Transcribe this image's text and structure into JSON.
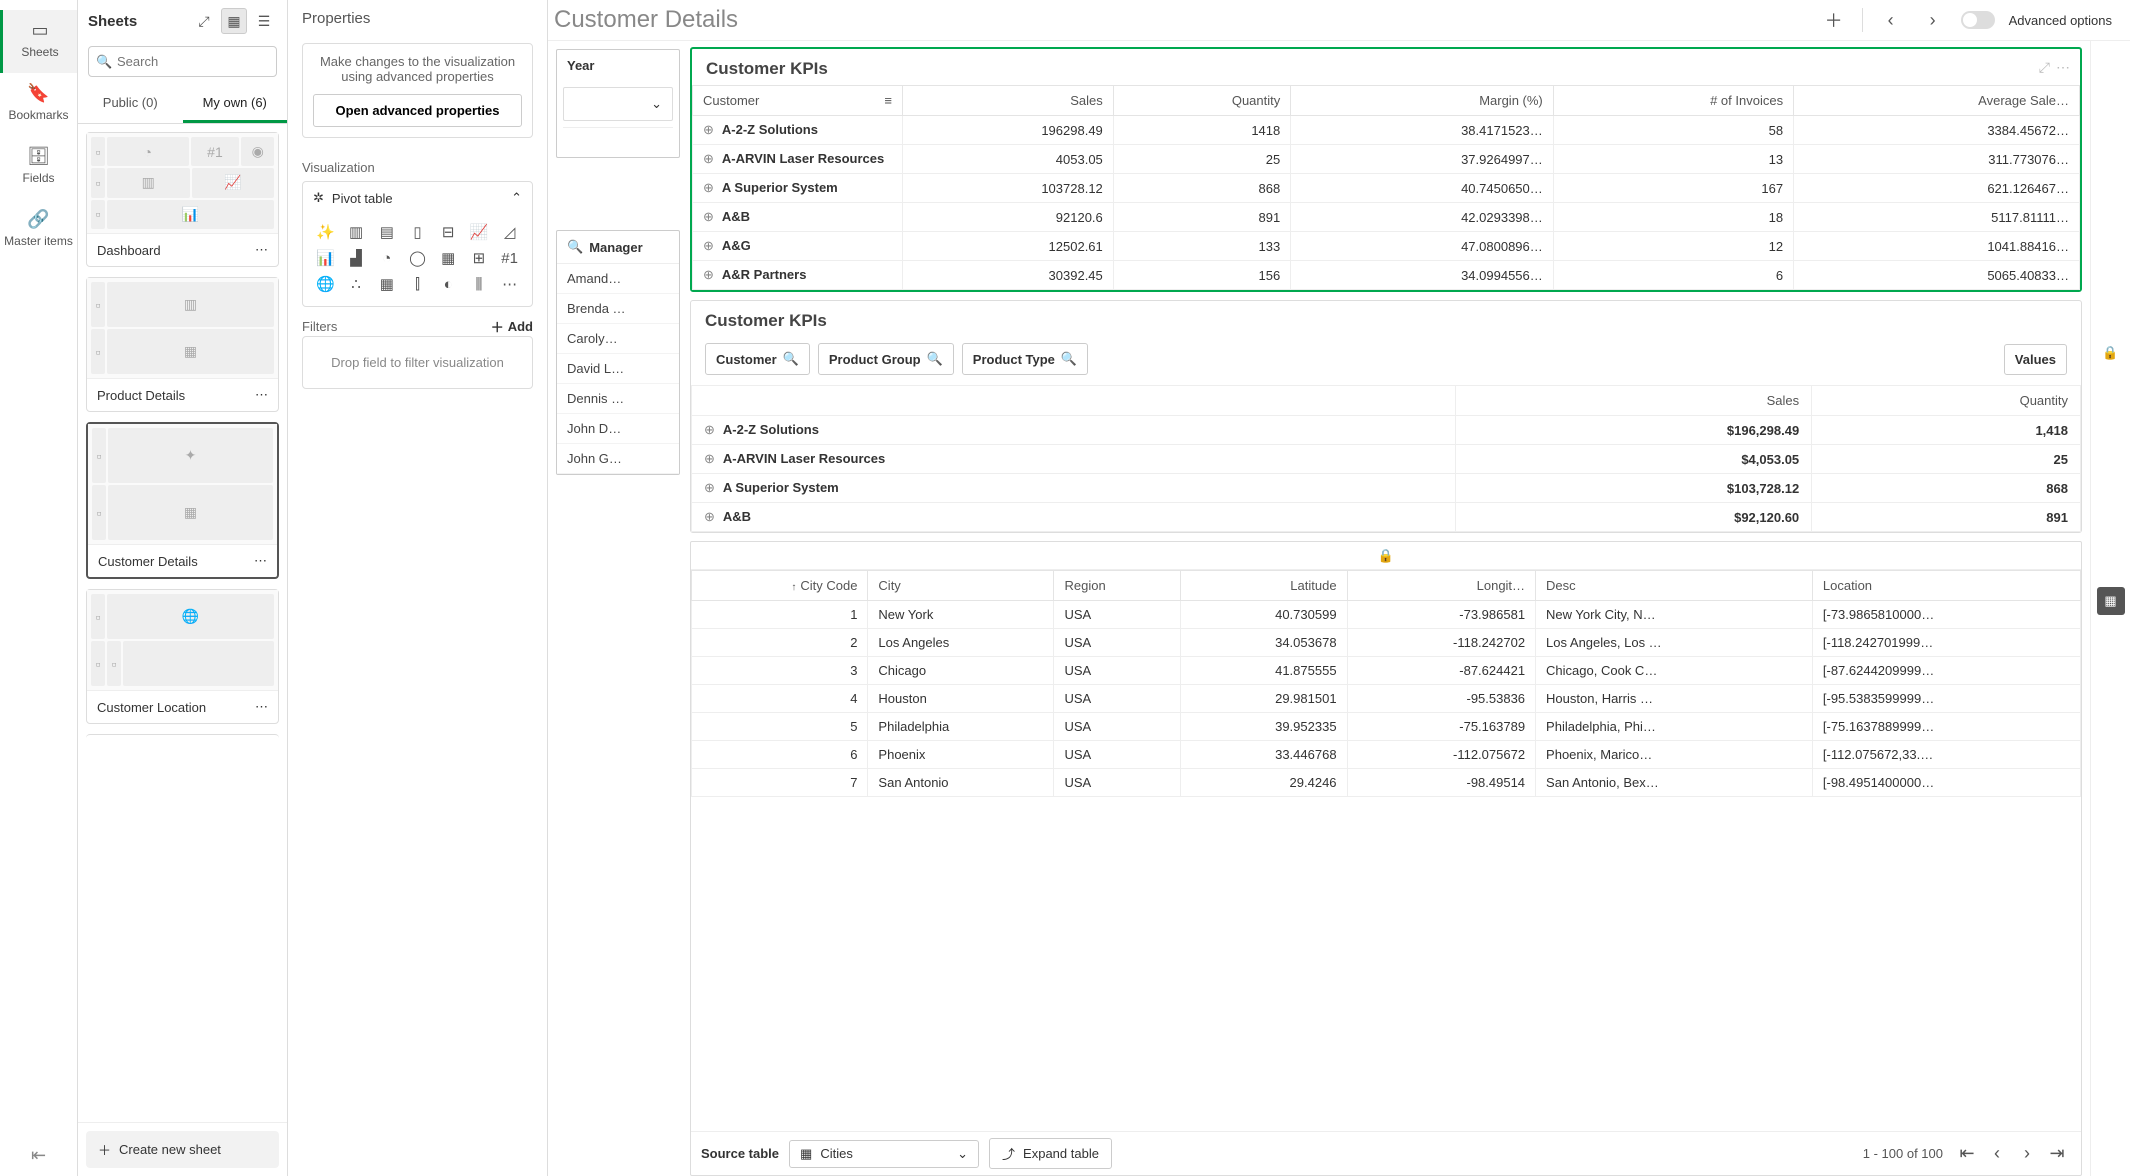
{
  "rail": {
    "sheets": "Sheets",
    "bookmarks": "Bookmarks",
    "fields": "Fields",
    "master": "Master items"
  },
  "sidebar": {
    "title": "Sheets",
    "search_placeholder": "Search",
    "tabs": {
      "public": "Public (0)",
      "myown": "My own (6)"
    },
    "sheets": [
      {
        "name": "Dashboard"
      },
      {
        "name": "Product Details"
      },
      {
        "name": "Customer Details"
      },
      {
        "name": "Customer Location"
      }
    ],
    "create": "Create new sheet"
  },
  "props": {
    "title": "Properties",
    "hint": "Make changes to the visualization using advanced properties",
    "open": "Open advanced properties",
    "viz_label": "Visualization",
    "viz_value": "Pivot table",
    "filters_label": "Filters",
    "add": "Add",
    "drop": "Drop field to filter visualization"
  },
  "header": {
    "title": "Customer Details",
    "advanced": "Advanced options"
  },
  "yearFilter": {
    "title": "Year"
  },
  "managerFilter": {
    "title": "Manager",
    "items": [
      "Amand…",
      "Brenda …",
      "Caroly…",
      "David L…",
      "Dennis …",
      "John D…",
      "John G…"
    ]
  },
  "kpi1": {
    "title": "Customer KPIs",
    "cols": [
      "Customer",
      "Sales",
      "Quantity",
      "Margin (%)",
      "# of Invoices",
      "Average Sale…"
    ],
    "rows": [
      [
        "A-2-Z Solutions",
        "196298.49",
        "1418",
        "38.4171523…",
        "58",
        "3384.45672…"
      ],
      [
        "A-ARVIN Laser Resources",
        "4053.05",
        "25",
        "37.9264997…",
        "13",
        "311.773076…"
      ],
      [
        "A Superior System",
        "103728.12",
        "868",
        "40.7450650…",
        "167",
        "621.126467…"
      ],
      [
        "A&B",
        "92120.6",
        "891",
        "42.0293398…",
        "18",
        "5117.81111…"
      ],
      [
        "A&G",
        "12502.61",
        "133",
        "47.0800896…",
        "12",
        "1041.88416…"
      ],
      [
        "A&R Partners",
        "30392.45",
        "156",
        "34.0994556…",
        "6",
        "5065.40833…"
      ]
    ]
  },
  "kpi2": {
    "title": "Customer KPIs",
    "chips": [
      "Customer",
      "Product Group",
      "Product Type"
    ],
    "values": "Values",
    "cols": [
      "Sales",
      "Quantity"
    ],
    "rows": [
      [
        "A-2-Z Solutions",
        "$196,298.49",
        "1,418"
      ],
      [
        "A-ARVIN Laser Resources",
        "$4,053.05",
        "25"
      ],
      [
        "A Superior System",
        "$103,728.12",
        "868"
      ],
      [
        "A&B",
        "$92,120.60",
        "891"
      ]
    ]
  },
  "dataTable": {
    "cols": [
      "City Code",
      "City",
      "Region",
      "Latitude",
      "Longit…",
      "Desc",
      "Location"
    ],
    "rows": [
      [
        "1",
        "New York",
        "USA",
        "40.730599",
        "-73.986581",
        "New York City, N…",
        "[-73.9865810000…"
      ],
      [
        "2",
        "Los Angeles",
        "USA",
        "34.053678",
        "-118.242702",
        "Los Angeles, Los …",
        "[-118.242701999…"
      ],
      [
        "3",
        "Chicago",
        "USA",
        "41.875555",
        "-87.624421",
        "Chicago, Cook C…",
        "[-87.6244209999…"
      ],
      [
        "4",
        "Houston",
        "USA",
        "29.981501",
        "-95.53836",
        "Houston, Harris …",
        "[-95.5383599999…"
      ],
      [
        "5",
        "Philadelphia",
        "USA",
        "39.952335",
        "-75.163789",
        "Philadelphia, Phi…",
        "[-75.1637889999…"
      ],
      [
        "6",
        "Phoenix",
        "USA",
        "33.446768",
        "-112.075672",
        "Phoenix, Marico…",
        "[-112.075672,33.…"
      ],
      [
        "7",
        "San Antonio",
        "USA",
        "29.4246",
        "-98.49514",
        "San Antonio, Bex…",
        "[-98.4951400000…"
      ]
    ],
    "source_label": "Source table",
    "source_value": "Cities",
    "expand": "Expand table",
    "pager": "1 - 100 of 100"
  }
}
